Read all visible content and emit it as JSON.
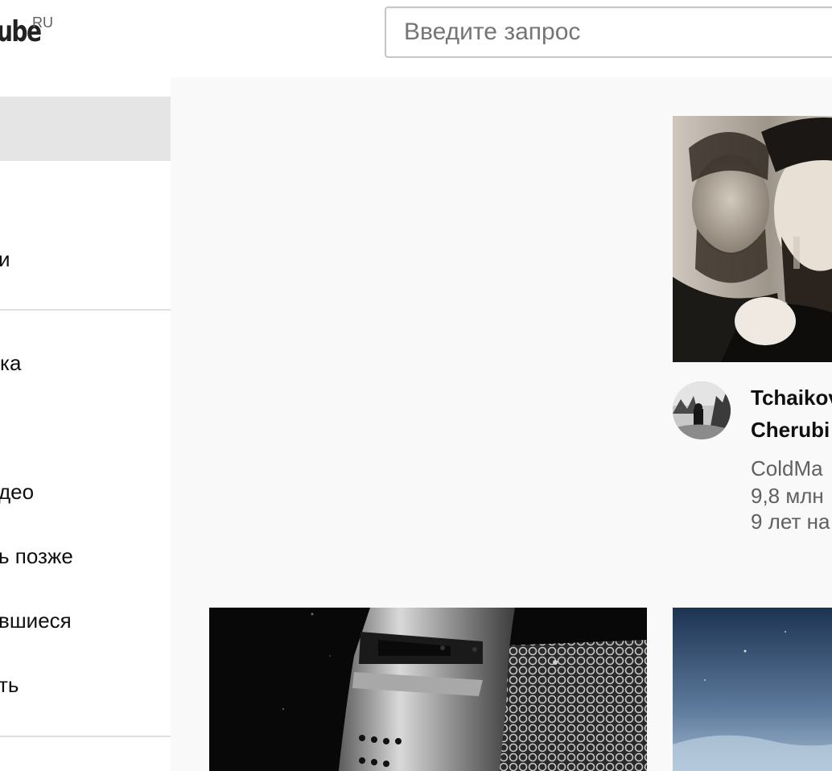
{
  "header": {
    "logo_text": "ube",
    "logo_region": "RU",
    "search_placeholder": "Введите запрос"
  },
  "sidebar": {
    "items": [
      {
        "label": ""
      },
      {
        "label": "и"
      },
      {
        "label": "ка"
      },
      {
        "label": "део"
      },
      {
        "label": "ь позже"
      },
      {
        "label": "вшиеся"
      },
      {
        "label": "ть"
      }
    ]
  },
  "videos": [
    {
      "title_line1": "Tchaikov",
      "title_line2": "Cherubi",
      "channel": "ColdMa",
      "views": "9,8 млн",
      "age": "9 лет на"
    }
  ],
  "colors": {
    "active_nav": "#e5e5e5",
    "main_bg": "#f9f9f9",
    "meta_text": "#606060"
  }
}
